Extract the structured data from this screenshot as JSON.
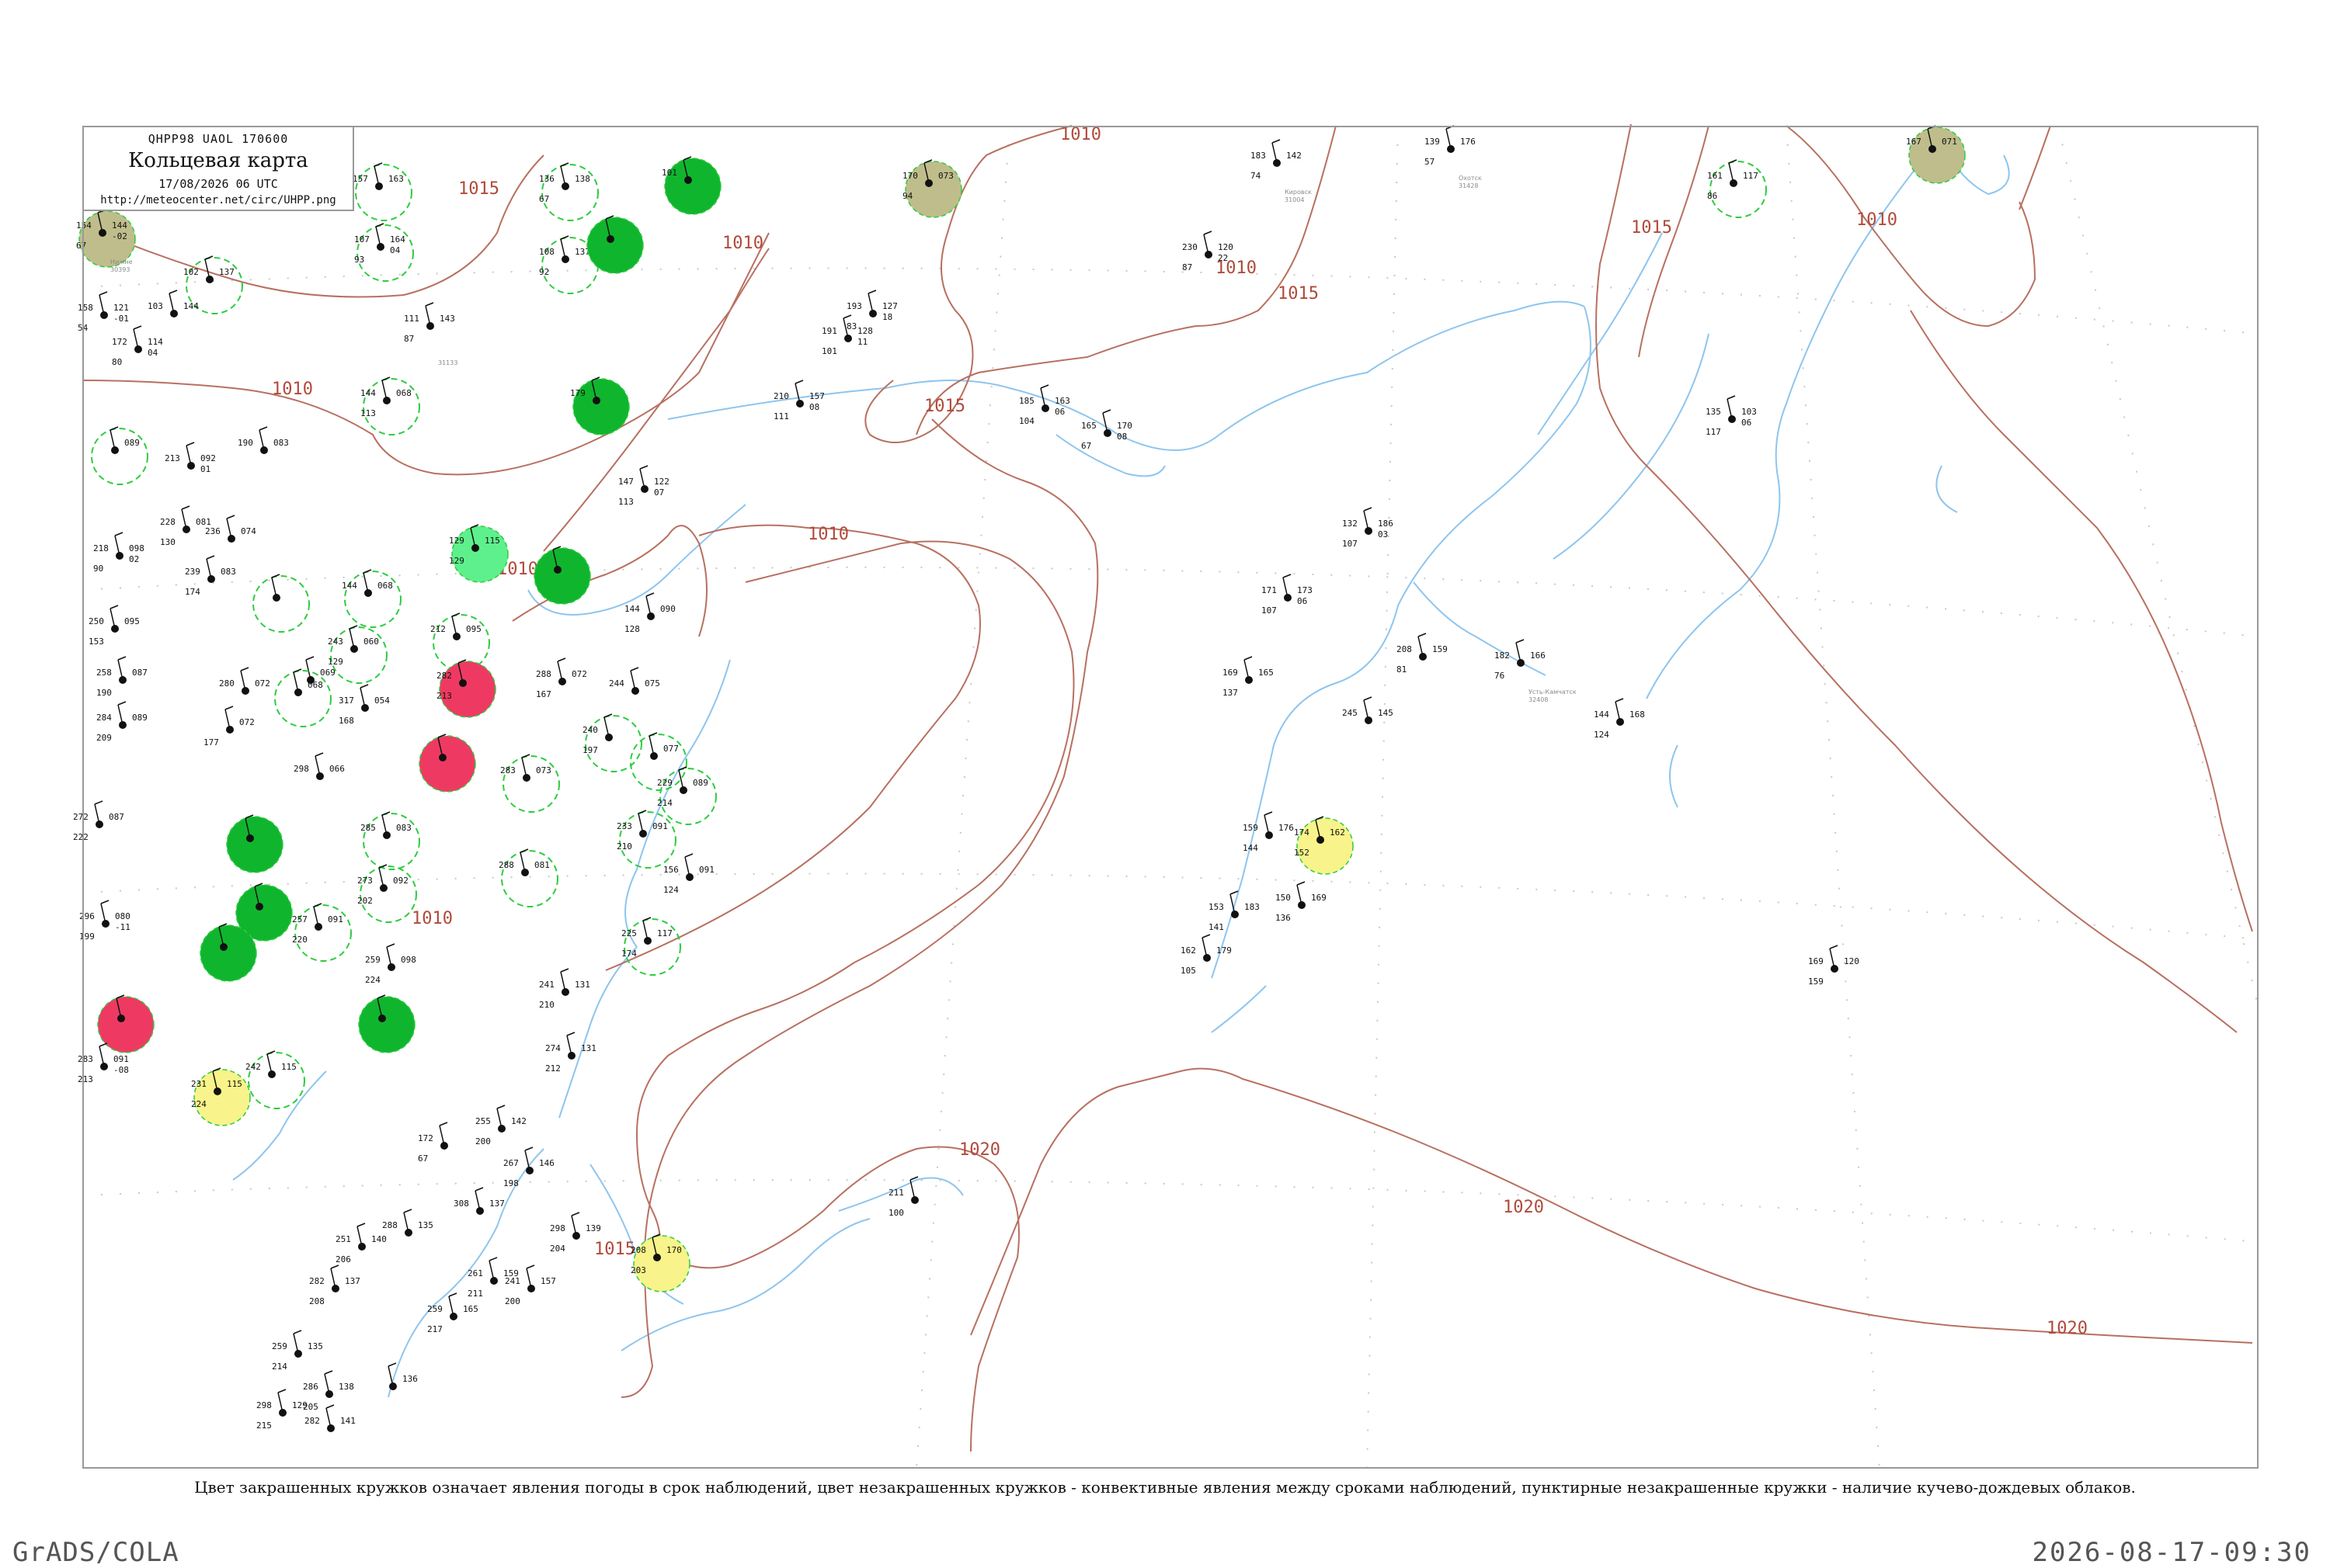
{
  "header": {
    "code": "QHPP98 UAOL 170600",
    "title": "Кольцевая карта",
    "date": "17/08/2026 06 UTC",
    "url": "http://meteocenter.net/circ/UHPP.png"
  },
  "caption": "Цвет закрашенных кружков означает явления погоды в срок наблюдений, цвет незакрашенных кружков - конвективные явления между сроками наблюдений, пунктирные незакрашенные кружки - наличие кучево-дождевых облаков.",
  "footer": {
    "left": "GrADS/COLA",
    "right": "2026-08-17-09:30"
  },
  "colors": {
    "isobar": "#b87060",
    "river": "#8ec5ee",
    "grid": "#c8c8c8",
    "green": "#10b52e",
    "light_green": "#5ef08c",
    "red": "#ee3a62",
    "olive": "#bfbd8c",
    "yellow": "#f8f38a",
    "dashed": "#2ecc40"
  },
  "isobars": [
    {
      "label": "1015",
      "id": "a"
    },
    {
      "label": "1010",
      "id": "b"
    },
    {
      "label": "1010",
      "id": "c"
    },
    {
      "label": "1010",
      "id": "d"
    },
    {
      "label": "1015",
      "id": "e"
    },
    {
      "label": "1010",
      "id": "f"
    },
    {
      "label": "1015",
      "id": "g"
    },
    {
      "label": "1010",
      "id": "h"
    },
    {
      "label": "1015",
      "id": "i"
    },
    {
      "label": "1010",
      "id": "j"
    },
    {
      "label": "1010",
      "id": "k"
    },
    {
      "label": "1020",
      "id": "l"
    },
    {
      "label": "1020",
      "id": "m"
    },
    {
      "label": "1020",
      "id": "n"
    },
    {
      "label": "1015",
      "id": "o"
    },
    {
      "label": "1010",
      "id": "p"
    }
  ],
  "stations": [
    {
      "id": "s1",
      "name": "Нижне",
      "index": "30393",
      "p": "144",
      "t": "154",
      "dp": "67",
      "tend": "-02",
      "marker": "olive"
    },
    {
      "id": "s2",
      "name": "",
      "index": "",
      "p": "163",
      "t": "157",
      "dp": "",
      "tend": "",
      "marker": "dashed"
    },
    {
      "id": "s3",
      "name": "",
      "index": "",
      "p": "138",
      "t": "136",
      "dp": "67",
      "tend": "",
      "marker": "dashed"
    },
    {
      "id": "s4",
      "name": "",
      "index": "",
      "p": "",
      "t": "101",
      "dp": "",
      "tend": "",
      "marker": "green"
    },
    {
      "id": "s5",
      "name": "",
      "index": "",
      "p": "164",
      "t": "107",
      "dp": "93",
      "tend": "04",
      "marker": "dashed"
    },
    {
      "id": "s6",
      "name": "",
      "index": "",
      "p": "137",
      "t": "108",
      "dp": "92",
      "tend": "",
      "marker": "dashed"
    },
    {
      "id": "s7",
      "name": "",
      "index": "",
      "p": "",
      "t": "",
      "dp": "",
      "tend": "",
      "marker": "green"
    },
    {
      "id": "s8",
      "name": "",
      "index": "",
      "p": "073",
      "t": "170",
      "dp": "94",
      "tend": "",
      "marker": "olive"
    },
    {
      "id": "s9",
      "name": "Кировск",
      "index": "31004",
      "p": "142",
      "t": "183",
      "dp": "74",
      "tend": "",
      "marker": "none"
    },
    {
      "id": "s10",
      "name": "Охотск",
      "index": "31428",
      "p": "176",
      "t": "139",
      "dp": "57",
      "tend": "",
      "marker": "none"
    },
    {
      "id": "s11",
      "name": "",
      "index": "",
      "p": "117",
      "t": "161",
      "dp": "86",
      "tend": "",
      "marker": "dashed"
    },
    {
      "id": "s12",
      "name": "",
      "index": "",
      "p": "071",
      "t": "167",
      "dp": "",
      "tend": "",
      "marker": "olive"
    },
    {
      "id": "s13",
      "name": "",
      "index": "",
      "p": "137",
      "t": "102",
      "dp": "",
      "tend": "",
      "marker": "dashed"
    },
    {
      "id": "s14",
      "name": "",
      "index": "",
      "p": "121",
      "t": "158",
      "dp": "54",
      "tend": "-01",
      "marker": "none"
    },
    {
      "id": "s15",
      "name": "",
      "index": "",
      "p": "144",
      "t": "103",
      "dp": "",
      "tend": "",
      "marker": "none"
    },
    {
      "id": "s16",
      "name": "",
      "index": "",
      "p": "114",
      "t": "172",
      "dp": "80",
      "tend": "04",
      "marker": "none"
    },
    {
      "id": "s17",
      "name": "",
      "index": "31133",
      "p": "143",
      "t": "111",
      "dp": "87",
      "tend": "",
      "marker": "none"
    },
    {
      "id": "s18",
      "name": "",
      "index": "",
      "p": "120",
      "t": "230",
      "dp": "87",
      "tend": "22",
      "marker": "none"
    },
    {
      "id": "s19",
      "name": "",
      "index": "",
      "p": "127",
      "t": "193",
      "dp": "83",
      "tend": "18",
      "marker": "none"
    },
    {
      "id": "s20",
      "name": "",
      "index": "",
      "p": "128",
      "t": "191",
      "dp": "101",
      "tend": "11",
      "marker": "none"
    },
    {
      "id": "s21",
      "name": "",
      "index": "",
      "p": "068",
      "t": "144",
      "dp": "113",
      "tend": "",
      "marker": "dashed"
    },
    {
      "id": "s22",
      "name": "",
      "index": "",
      "p": "",
      "t": "179",
      "dp": "",
      "tend": "",
      "marker": "green"
    },
    {
      "id": "s23",
      "name": "",
      "index": "",
      "p": "157",
      "t": "210",
      "dp": "111",
      "tend": "08",
      "marker": "none"
    },
    {
      "id": "s24",
      "name": "",
      "index": "",
      "p": "163",
      "t": "185",
      "dp": "104",
      "tend": "06",
      "marker": "none"
    },
    {
      "id": "s25",
      "name": "",
      "index": "",
      "p": "170",
      "t": "165",
      "dp": "67",
      "tend": "08",
      "marker": "none"
    },
    {
      "id": "s26",
      "name": "",
      "index": "",
      "p": "103",
      "t": "135",
      "dp": "117",
      "tend": "06",
      "marker": "none"
    },
    {
      "id": "s27",
      "name": "",
      "index": "",
      "p": "089",
      "t": "",
      "dp": "",
      "tend": "",
      "marker": "dashed"
    },
    {
      "id": "s28",
      "name": "",
      "index": "",
      "p": "083",
      "t": "190",
      "dp": "",
      "tend": "",
      "marker": "none"
    },
    {
      "id": "s29",
      "name": "",
      "index": "",
      "p": "092",
      "t": "213",
      "dp": "",
      "tend": "01",
      "marker": "none"
    },
    {
      "id": "s30",
      "name": "",
      "index": "",
      "p": "122",
      "t": "147",
      "dp": "113",
      "tend": "07",
      "marker": "none"
    },
    {
      "id": "s31",
      "name": "",
      "index": "",
      "p": "115",
      "t": "129",
      "dp": "129",
      "tend": "",
      "marker": "light_green"
    },
    {
      "id": "s32",
      "name": "",
      "index": "",
      "p": "",
      "t": "",
      "dp": "",
      "tend": "",
      "marker": "green"
    },
    {
      "id": "s33",
      "name": "",
      "index": "",
      "p": "081",
      "t": "228",
      "dp": "130",
      "tend": "",
      "marker": "none"
    },
    {
      "id": "s34",
      "name": "",
      "index": "",
      "p": "074",
      "t": "236",
      "dp": "",
      "tend": "",
      "marker": "none"
    },
    {
      "id": "s35",
      "name": "",
      "index": "",
      "p": "098",
      "t": "218",
      "dp": "90",
      "tend": "02",
      "marker": "none"
    },
    {
      "id": "s36",
      "name": "",
      "index": "",
      "p": "083",
      "t": "239",
      "dp": "174",
      "tend": "",
      "marker": "none"
    },
    {
      "id": "s37",
      "name": "",
      "index": "",
      "p": "",
      "t": "",
      "dp": "",
      "tend": "",
      "marker": "dashed"
    },
    {
      "id": "s38",
      "name": "",
      "index": "",
      "p": "068",
      "t": "144",
      "dp": "",
      "tend": "",
      "marker": "dashed"
    },
    {
      "id": "s39",
      "name": "Усть-Камчатск",
      "index": "32408",
      "p": "166",
      "t": "182",
      "dp": "76",
      "tend": "",
      "marker": "none"
    },
    {
      "id": "s40",
      "name": "",
      "index": "",
      "p": "186",
      "t": "132",
      "dp": "107",
      "tend": "03",
      "marker": "none"
    },
    {
      "id": "s41",
      "name": "",
      "index": "",
      "p": "173",
      "t": "171",
      "dp": "107",
      "tend": "06",
      "marker": "none"
    },
    {
      "id": "s42",
      "name": "",
      "index": "",
      "p": "159",
      "t": "208",
      "dp": "81",
      "tend": "",
      "marker": "none"
    },
    {
      "id": "s43",
      "name": "",
      "index": "",
      "p": "095",
      "t": "250",
      "dp": "153",
      "tend": "",
      "marker": "none"
    },
    {
      "id": "s44",
      "name": "",
      "index": "",
      "p": "095",
      "t": "212",
      "dp": "",
      "tend": "",
      "marker": "dashed"
    },
    {
      "id": "s45",
      "name": "",
      "index": "",
      "p": "060",
      "t": "243",
      "dp": "129",
      "tend": "",
      "marker": "dashed"
    },
    {
      "id": "s46",
      "name": "",
      "index": "",
      "p": "090",
      "t": "144",
      "dp": "128",
      "tend": "",
      "marker": "none"
    },
    {
      "id": "s47",
      "name": "",
      "index": "",
      "p": "",
      "t": "282",
      "dp": "213",
      "tend": "",
      "marker": "red"
    },
    {
      "id": "s48",
      "name": "",
      "index": "",
      "p": "072",
      "t": "288",
      "dp": "167",
      "tend": "",
      "marker": "none"
    },
    {
      "id": "s49",
      "name": "",
      "index": "",
      "p": "075",
      "t": "244",
      "dp": "",
      "tend": "",
      "marker": "none"
    },
    {
      "id": "s50",
      "name": "",
      "index": "",
      "p": "165",
      "t": "169",
      "dp": "137",
      "tend": "",
      "marker": "none"
    },
    {
      "id": "s51",
      "name": "",
      "index": "",
      "p": "145",
      "t": "245",
      "dp": "",
      "tend": "",
      "marker": "none"
    },
    {
      "id": "s52",
      "name": "",
      "index": "",
      "p": "168",
      "t": "144",
      "dp": "124",
      "tend": "",
      "marker": "none"
    },
    {
      "id": "s53",
      "name": "",
      "index": "",
      "p": "087",
      "t": "258",
      "dp": "190",
      "tend": "",
      "marker": "none"
    },
    {
      "id": "s54",
      "name": "",
      "index": "",
      "p": "069",
      "t": "",
      "dp": "",
      "tend": "",
      "marker": "none"
    },
    {
      "id": "s55",
      "name": "",
      "index": "",
      "p": "072",
      "t": "280",
      "dp": "",
      "tend": "",
      "marker": "none"
    },
    {
      "id": "s56",
      "name": "",
      "index": "",
      "p": "068",
      "t": "",
      "dp": "",
      "tend": "",
      "marker": "dashed"
    },
    {
      "id": "s57",
      "name": "",
      "index": "",
      "p": "054",
      "t": "317",
      "dp": "168",
      "tend": "",
      "marker": "none"
    },
    {
      "id": "s58",
      "name": "",
      "index": "",
      "p": "089",
      "t": "284",
      "dp": "209",
      "tend": "",
      "marker": "none"
    },
    {
      "id": "s59",
      "name": "",
      "index": "",
      "p": "072",
      "t": "",
      "dp": "177",
      "tend": "",
      "marker": "none"
    },
    {
      "id": "s60",
      "name": "",
      "index": "",
      "p": "",
      "t": "",
      "dp": "",
      "tend": "",
      "marker": "red"
    },
    {
      "id": "s61",
      "name": "",
      "index": "",
      "p": "",
      "t": "240",
      "dp": "197",
      "tend": "",
      "marker": "dashed"
    },
    {
      "id": "s62",
      "name": "",
      "index": "",
      "p": "077",
      "t": "",
      "dp": "",
      "tend": "",
      "marker": "dashed"
    },
    {
      "id": "s63",
      "name": "",
      "index": "",
      "p": "066",
      "t": "298",
      "dp": "",
      "tend": "",
      "marker": "none"
    },
    {
      "id": "s64",
      "name": "",
      "index": "",
      "p": "073",
      "t": "283",
      "dp": "",
      "tend": "",
      "marker": "dashed"
    },
    {
      "id": "s65",
      "name": "",
      "index": "",
      "p": "089",
      "t": "229",
      "dp": "214",
      "tend": "",
      "marker": "dashed"
    },
    {
      "id": "s66",
      "name": "",
      "index": "",
      "p": "",
      "t": "",
      "dp": "",
      "tend": "",
      "marker": "green"
    },
    {
      "id": "s67",
      "name": "",
      "index": "",
      "p": "087",
      "t": "272",
      "dp": "222",
      "tend": "",
      "marker": "none"
    },
    {
      "id": "s68",
      "name": "",
      "index": "",
      "p": "083",
      "t": "285",
      "dp": "",
      "tend": "",
      "marker": "dashed"
    },
    {
      "id": "s69",
      "name": "",
      "index": "",
      "p": "091",
      "t": "233",
      "dp": "210",
      "tend": "",
      "marker": "dashed"
    },
    {
      "id": "s70",
      "name": "",
      "index": "",
      "p": "091",
      "t": "156",
      "dp": "124",
      "tend": "",
      "marker": "none"
    },
    {
      "id": "s71",
      "name": "",
      "index": "",
      "p": "162",
      "t": "174",
      "dp": "152",
      "tend": "",
      "marker": "yellow"
    },
    {
      "id": "s72",
      "name": "",
      "index": "",
      "p": "176",
      "t": "159",
      "dp": "144",
      "tend": "",
      "marker": "none"
    },
    {
      "id": "s73",
      "name": "",
      "index": "",
      "p": "081",
      "t": "288",
      "dp": "",
      "tend": "",
      "marker": "dashed"
    },
    {
      "id": "s74",
      "name": "",
      "index": "",
      "p": "092",
      "t": "273",
      "dp": "202",
      "tend": "",
      "marker": "dashed"
    },
    {
      "id": "s75",
      "name": "",
      "index": "",
      "p": "",
      "t": "",
      "dp": "",
      "tend": "",
      "marker": "green"
    },
    {
      "id": "s76",
      "name": "",
      "index": "",
      "p": "091",
      "t": "257",
      "dp": "220",
      "tend": "",
      "marker": "dashed"
    },
    {
      "id": "s77",
      "name": "",
      "index": "",
      "p": "080",
      "t": "296",
      "dp": "199",
      "tend": "-11",
      "marker": "none"
    },
    {
      "id": "s78",
      "name": "",
      "index": "",
      "p": "",
      "t": "",
      "dp": "",
      "tend": "",
      "marker": "green"
    },
    {
      "id": "s79",
      "name": "",
      "index": "",
      "p": "169",
      "t": "150",
      "dp": "136",
      "tend": "",
      "marker": "none"
    },
    {
      "id": "s80",
      "name": "",
      "index": "",
      "p": "183",
      "t": "153",
      "dp": "141",
      "tend": "",
      "marker": "none"
    },
    {
      "id": "s81",
      "name": "",
      "index": "",
      "p": "179",
      "t": "162",
      "dp": "105",
      "tend": "",
      "marker": "none"
    },
    {
      "id": "s82",
      "name": "",
      "index": "",
      "p": "117",
      "t": "225",
      "dp": "174",
      "tend": "",
      "marker": "dashed"
    },
    {
      "id": "s83",
      "name": "",
      "index": "",
      "p": "120",
      "t": "169",
      "dp": "159",
      "tend": "",
      "marker": "none"
    },
    {
      "id": "s84",
      "name": "",
      "index": "",
      "p": "098",
      "t": "259",
      "dp": "224",
      "tend": "",
      "marker": "none"
    },
    {
      "id": "s85",
      "name": "",
      "index": "",
      "p": "131",
      "t": "241",
      "dp": "210",
      "tend": "",
      "marker": "none"
    },
    {
      "id": "s86",
      "name": "",
      "index": "",
      "p": "",
      "t": "",
      "dp": "",
      "tend": "",
      "marker": "red"
    },
    {
      "id": "s87",
      "name": "",
      "index": "",
      "p": "",
      "t": "",
      "dp": "",
      "tend": "",
      "marker": "green"
    },
    {
      "id": "s88",
      "name": "",
      "index": "",
      "p": "131",
      "t": "274",
      "dp": "212",
      "tend": "",
      "marker": "none"
    },
    {
      "id": "s89",
      "name": "",
      "index": "",
      "p": "091",
      "t": "283",
      "dp": "213",
      "tend": "-08",
      "marker": "none"
    },
    {
      "id": "s90",
      "name": "",
      "index": "",
      "p": "115",
      "t": "242",
      "dp": "",
      "tend": "",
      "marker": "dashed"
    },
    {
      "id": "s91",
      "name": "",
      "index": "",
      "p": "115",
      "t": "231",
      "dp": "224",
      "tend": "",
      "marker": "yellow"
    },
    {
      "id": "s92",
      "name": "",
      "index": "",
      "p": "142",
      "t": "255",
      "dp": "200",
      "tend": "",
      "marker": "none"
    },
    {
      "id": "s93",
      "name": "",
      "index": "",
      "p": "",
      "t": "172",
      "dp": "67",
      "tend": "",
      "marker": "none"
    },
    {
      "id": "s94",
      "name": "",
      "index": "",
      "p": "146",
      "t": "267",
      "dp": "198",
      "tend": "",
      "marker": "none"
    },
    {
      "id": "s95",
      "name": "",
      "index": "",
      "p": "137",
      "t": "308",
      "dp": "",
      "tend": "",
      "marker": "none"
    },
    {
      "id": "s96",
      "name": "",
      "index": "",
      "p": "135",
      "t": "288",
      "dp": "",
      "tend": "",
      "marker": "none"
    },
    {
      "id": "s97",
      "name": "",
      "index": "",
      "p": "140",
      "t": "251",
      "dp": "206",
      "tend": "",
      "marker": "none"
    },
    {
      "id": "s98",
      "name": "",
      "index": "",
      "p": "139",
      "t": "298",
      "dp": "204",
      "tend": "",
      "marker": "none"
    },
    {
      "id": "s99",
      "name": "",
      "index": "",
      "p": "170",
      "t": "208",
      "dp": "203",
      "tend": "",
      "marker": "yellow"
    },
    {
      "id": "s100",
      "name": "",
      "index": "",
      "p": "",
      "t": "211",
      "dp": "100",
      "tend": "",
      "marker": "none"
    },
    {
      "id": "s101",
      "name": "",
      "index": "",
      "p": "159",
      "t": "261",
      "dp": "211",
      "tend": "",
      "marker": "none"
    },
    {
      "id": "s102",
      "name": "",
      "index": "",
      "p": "157",
      "t": "241",
      "dp": "200",
      "tend": "",
      "marker": "none"
    },
    {
      "id": "s103",
      "name": "",
      "index": "",
      "p": "137",
      "t": "282",
      "dp": "208",
      "tend": "",
      "marker": "none"
    },
    {
      "id": "s104",
      "name": "",
      "index": "",
      "p": "165",
      "t": "259",
      "dp": "217",
      "tend": "",
      "marker": "none"
    },
    {
      "id": "s105",
      "name": "",
      "index": "",
      "p": "135",
      "t": "259",
      "dp": "214",
      "tend": "",
      "marker": "none"
    },
    {
      "id": "s106",
      "name": "",
      "index": "",
      "p": "138",
      "t": "286",
      "dp": "205",
      "tend": "",
      "marker": "none"
    },
    {
      "id": "s107",
      "name": "",
      "index": "",
      "p": "136",
      "t": "",
      "dp": "",
      "tend": "",
      "marker": "none"
    },
    {
      "id": "s108",
      "name": "",
      "index": "",
      "p": "129",
      "t": "298",
      "dp": "215",
      "tend": "",
      "marker": "none"
    },
    {
      "id": "s109",
      "name": "",
      "index": "",
      "p": "141",
      "t": "282",
      "dp": "",
      "tend": "",
      "marker": "none"
    }
  ]
}
